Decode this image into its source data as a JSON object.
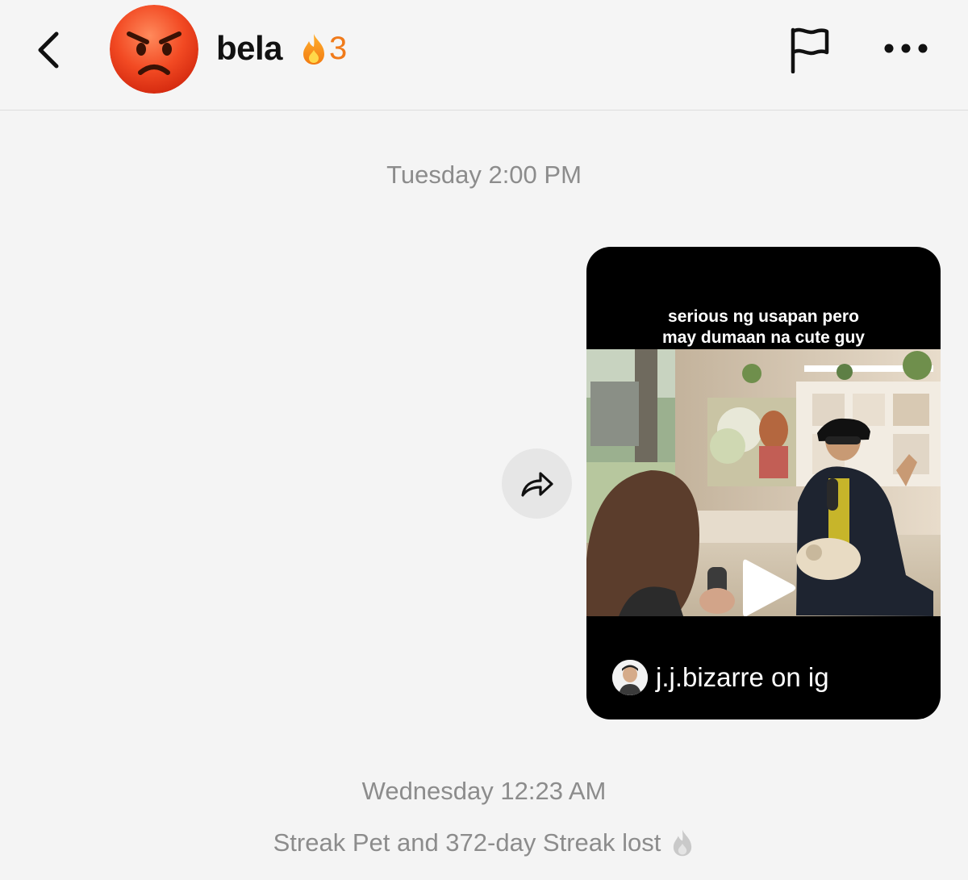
{
  "header": {
    "back_icon": "chevron-left-icon",
    "avatar_icon": "angry-face-emoji",
    "contact_name": "bela",
    "streak_icon": "fire-icon",
    "streak_count": "3",
    "flag_icon": "flag-icon",
    "more_icon": "ellipsis-icon"
  },
  "messages": {
    "timestamp_1": "Tuesday 2:00 PM",
    "shared_video": {
      "caption_line_1": "serious ng usapan pero",
      "caption_line_2": "may dumaan na cute guy",
      "source": "j.j.bizarre on ig",
      "play_icon": "play-icon"
    },
    "share_icon": "share-arrow-icon",
    "timestamp_2": "Wednesday 12:23 AM",
    "system_message": "Streak Pet and 372-day Streak lost"
  },
  "colors": {
    "background": "#f4f4f4",
    "streak_orange": "#f07a1a",
    "muted_text": "#8c8c8c",
    "card_black": "#000000"
  }
}
